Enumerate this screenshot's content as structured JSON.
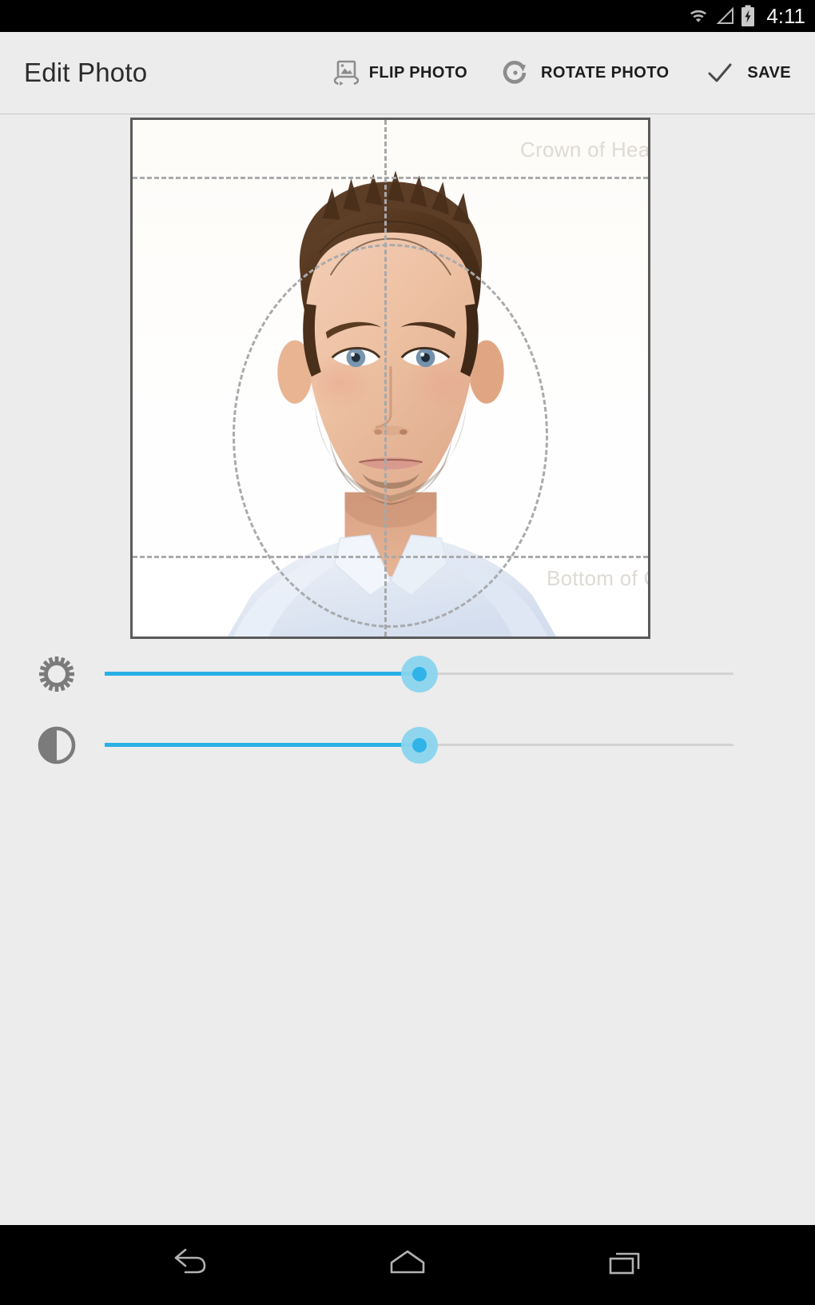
{
  "status_bar": {
    "time": "4:11",
    "icons": [
      "wifi-icon",
      "cellular-signal-icon",
      "battery-charging-icon"
    ]
  },
  "action_bar": {
    "title": "Edit Photo",
    "actions": [
      {
        "id": "flip",
        "label": "FLIP PHOTO",
        "icon": "flip-photo-icon"
      },
      {
        "id": "rotate",
        "label": "ROTATE PHOTO",
        "icon": "rotate-photo-icon"
      },
      {
        "id": "save",
        "label": "SAVE",
        "icon": "checkmark-icon"
      }
    ]
  },
  "photo_editor": {
    "guides": {
      "crown_label": "Crown of Head",
      "chin_label": "Bottom of Chin",
      "guide_color": "#a9aaac",
      "label_color": "#dedad4"
    },
    "subject": "portrait-photo"
  },
  "adjustments": [
    {
      "id": "brightness",
      "icon": "brightness-sun-icon",
      "value": 50,
      "min": 0,
      "max": 100
    },
    {
      "id": "contrast",
      "icon": "contrast-half-circle-icon",
      "value": 50,
      "min": 0,
      "max": 100
    }
  ],
  "theme": {
    "accent": "#29b0e5",
    "accent_light": "#8bd4ee",
    "background": "#ececec",
    "status_bar_bg": "#000000",
    "nav_bar_bg": "#000000"
  },
  "nav_bar": {
    "buttons": [
      {
        "id": "back",
        "icon": "back-arrow-icon"
      },
      {
        "id": "home",
        "icon": "home-icon"
      },
      {
        "id": "recents",
        "icon": "recents-icon"
      }
    ]
  }
}
